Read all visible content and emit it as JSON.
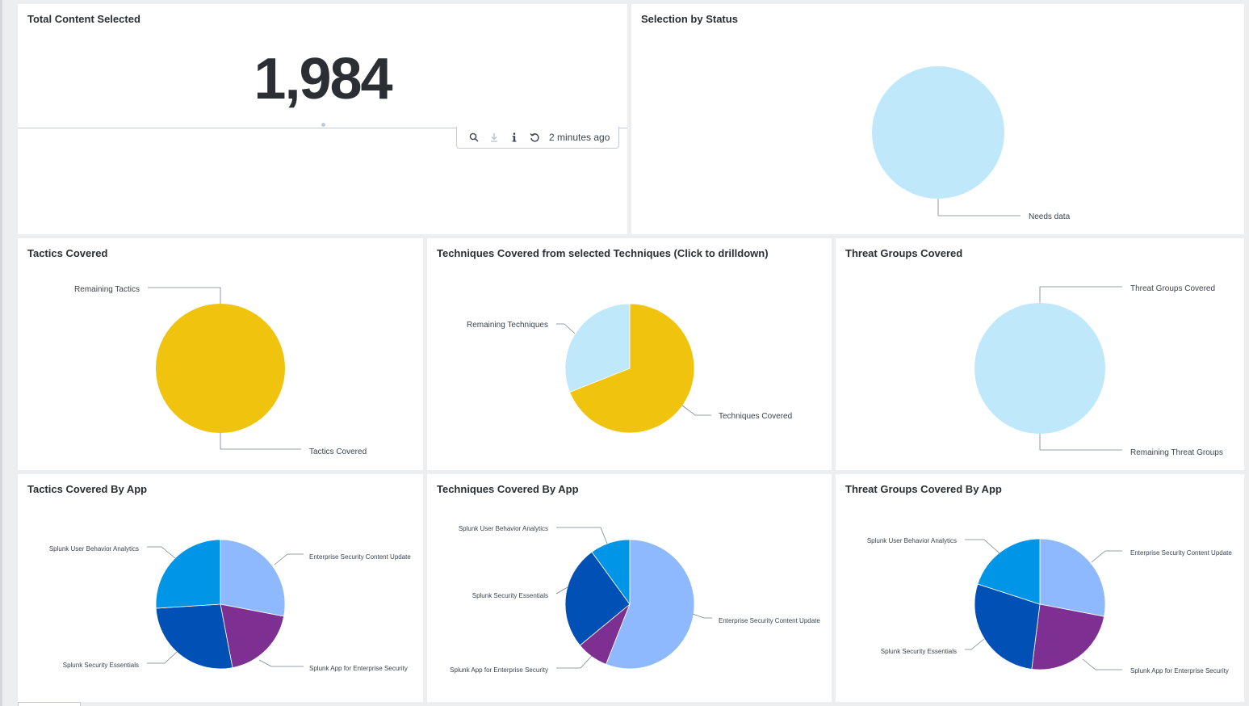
{
  "colors": {
    "light_blue": "#c0e8fb",
    "yellow": "#f0c30f",
    "periwinkle": "#8fb9ff",
    "purple": "#7e2f92",
    "royal_blue": "#0050b5",
    "sky_blue": "#0095e6",
    "leader": "#7a848e"
  },
  "total_content": {
    "title": "Total Content Selected",
    "value": "1,984",
    "toolbar": {
      "icons": [
        "search-icon",
        "download-icon",
        "info-icon",
        "refresh-icon"
      ],
      "time_text": "2 minutes ago"
    }
  },
  "selection_status": {
    "title": "Selection by Status"
  },
  "tactics": {
    "title": "Tactics Covered"
  },
  "techniques": {
    "title": "Techniques Covered from selected Techniques (Click to drilldown)"
  },
  "threat_groups": {
    "title": "Threat Groups Covered"
  },
  "tactics_app": {
    "title": "Tactics Covered By App"
  },
  "techniques_app": {
    "title": "Techniques Covered By App"
  },
  "threat_groups_app": {
    "title": "Threat Groups Covered By App"
  },
  "chart_data": [
    {
      "id": "selection_status",
      "type": "pie",
      "categories": [
        "Needs data"
      ],
      "values": [
        1
      ],
      "colors": [
        "#c0e8fb"
      ]
    },
    {
      "id": "tactics",
      "type": "pie",
      "categories": [
        "Tactics Covered",
        "Remaining Tactics"
      ],
      "values": [
        100,
        0
      ],
      "colors": [
        "#f0c30f",
        "#c0e8fb"
      ]
    },
    {
      "id": "techniques",
      "type": "pie",
      "categories": [
        "Techniques Covered",
        "Remaining Techniques"
      ],
      "values": [
        69,
        31
      ],
      "colors": [
        "#f0c30f",
        "#c0e8fb"
      ]
    },
    {
      "id": "threat_groups",
      "type": "pie",
      "categories": [
        "Remaining Threat Groups",
        "Threat Groups Covered"
      ],
      "values": [
        100,
        0
      ],
      "colors": [
        "#c0e8fb",
        "#f0c30f"
      ]
    },
    {
      "id": "tactics_app",
      "type": "pie",
      "categories": [
        "Enterprise Security Content Update",
        "Splunk App for Enterprise Security",
        "Splunk Security Essentials",
        "Splunk User Behavior Analytics"
      ],
      "values": [
        28,
        19,
        27,
        26
      ],
      "colors": [
        "#8fb9ff",
        "#7e2f92",
        "#0050b5",
        "#0095e6"
      ]
    },
    {
      "id": "techniques_app",
      "type": "pie",
      "categories": [
        "Enterprise Security Content Update",
        "Splunk App for Enterprise Security",
        "Splunk Security Essentials",
        "Splunk User Behavior Analytics"
      ],
      "values": [
        56,
        8,
        26,
        10
      ],
      "colors": [
        "#8fb9ff",
        "#7e2f92",
        "#0050b5",
        "#0095e6"
      ]
    },
    {
      "id": "threat_groups_app",
      "type": "pie",
      "categories": [
        "Enterprise Security Content Update",
        "Splunk App for Enterprise Security",
        "Splunk Security Essentials",
        "Splunk User Behavior Analytics"
      ],
      "values": [
        28,
        24,
        28,
        20
      ],
      "colors": [
        "#8fb9ff",
        "#7e2f92",
        "#0050b5",
        "#0095e6"
      ]
    }
  ]
}
